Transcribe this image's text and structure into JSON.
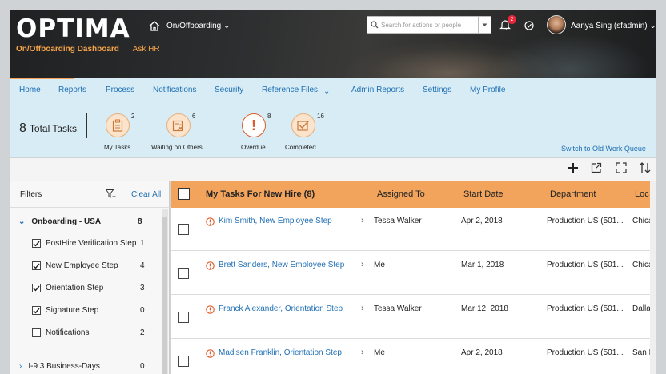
{
  "header": {
    "logo": "OPTIMA",
    "subnav": [
      "On/Offboarding Dashboard",
      "Ask HR"
    ],
    "module": "On/Offboarding",
    "search_placeholder": "Search for actions or people",
    "notification_count": "2",
    "user": "Aanya Sing (sfadmin)"
  },
  "menu": [
    "Home",
    "Reports",
    "Process",
    "Notifications",
    "Security",
    "Reference Files",
    "Admin Reports",
    "Settings",
    "My Profile"
  ],
  "summary": {
    "total_number": "8",
    "total_label": "Total Tasks",
    "tiles": [
      {
        "label": "My Tasks",
        "count": "2",
        "icon": "clipboard-icon"
      },
      {
        "label": "Waiting on Others",
        "count": "6",
        "icon": "people-clipboard-icon"
      },
      {
        "label": "Overdue",
        "count": "8",
        "icon": "exclamation-icon"
      },
      {
        "label": "Completed",
        "count": "16",
        "icon": "checkmark-icon"
      }
    ],
    "switch_link": "Switch to Old Work Queue"
  },
  "filters": {
    "title": "Filters",
    "clear_all": "Clear All",
    "group": {
      "label": "Onboarding - USA",
      "count": "8"
    },
    "items": [
      {
        "label": "PostHire Verification Step",
        "count": "1",
        "checked": true
      },
      {
        "label": "New Employee Step",
        "count": "4",
        "checked": true
      },
      {
        "label": "Orientation Step",
        "count": "3",
        "checked": true
      },
      {
        "label": "Signature Step",
        "count": "0",
        "checked": true
      },
      {
        "label": "Notifications",
        "count": "2",
        "checked": false
      }
    ],
    "next_group": {
      "label": "I-9 3 Business-Days",
      "count": "0"
    }
  },
  "table": {
    "title": "My Tasks For New Hire (8)",
    "columns": [
      "Assigned To",
      "Start Date",
      "Department",
      "Loc"
    ],
    "rows": [
      {
        "name": "Kim Smith, New Employee Step",
        "assigned": "Tessa Walker",
        "date": "Apr 2, 2018",
        "dept": "Production US (501...",
        "loc": "Chica"
      },
      {
        "name": "Brett Sanders, New Employee Step",
        "assigned": "Me",
        "date": "Mar 1, 2018",
        "dept": "Production US (501...",
        "loc": "Chica"
      },
      {
        "name": "Franck Alexander, Orientation Step",
        "assigned": "Tessa Walker",
        "date": "Mar 12, 2018",
        "dept": "Production US (501...",
        "loc": "Dalla"
      },
      {
        "name": "Madisen Franklin, Orientation Step",
        "assigned": "Me",
        "date": "Apr 2, 2018",
        "dept": "Production US (501...",
        "loc": "San F"
      }
    ]
  },
  "colors": {
    "accent": "#f2a45d",
    "link": "#1f6fb4",
    "alert": "#e05a2b",
    "nav_bg": "#d7ecf4"
  }
}
